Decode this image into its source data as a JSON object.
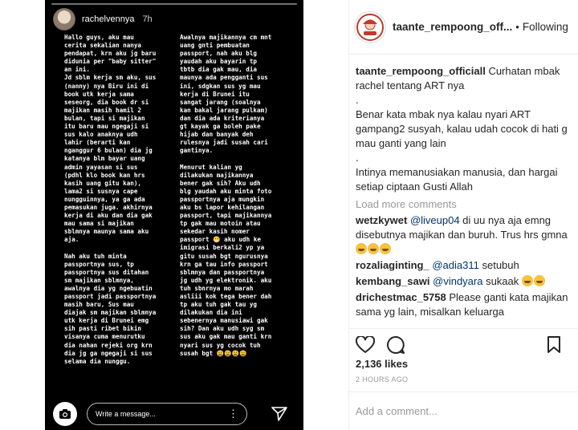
{
  "story": {
    "username": "rachelvennya",
    "time": "7h",
    "text_left": "Hallo guys, aku mau\ncerita sekalian nanya\npendapat, krn aku jg baru\ndidunia per \"baby sitter\"\nan ini.\nJd sblm kerja sm aku, sus\n(nanny) nya Biru ini di\nbook utk kerja sama\nseseorg, dia book dr si\nmajikan masih hamil 2\nbulan, tapi si majikan\nitu baru mau ngegaji si\nsus kalo anaknya udh\nlahir (berarti kan\nnganggur 6 bulan) dia jg\nkatanya blm bayar uang\nadmin yayasan si sus\n(pdhl klo book kan hrs\nkasih uang gitu kan),\nlama2 si susnya cape\nnungguinnya, ya ga ada\npemasukan juga. akhirnya\nkerja di aku dan dia gak\nmau sama si majikan\nsblmnya maunya sama aku\naja.\n\nNah aku tuh minta\npassportnya sus, tp\npassportnya sus ditahan\nsm majikan sblmnya,\nawalnya dia yg ngebuatin\npassport jadi passportnya\nmasih baru, Sus mau\ndiajak sm majikan sblmnya\nutk kerja di Brunei emg\nsih pasti ribet bikin\nvisanya cuma menurutku\ndia nahan rejeki org krn\ndia jg ga ngegaji si sus\nselama dia nunggu.",
    "text_right": "Awalnya majikannya cm mnt\nuang gnti pembuatan\npassport, nah aku blg\nyaudah aku bayarin tp\ntbtb dia gak mau, dia\nmaunya ada pengganti sus\nini, sdgkan sus yg mau\nkerja di Brunei itu\nsangat jarang (soalnya\nkan bakal jarang pulkam)\ndan dia ada kriterianya\ngt kayak ga boleh pake\nhijab dan banyak deh\nrulesnya jadi susah cari\ngantinya.\n\nMenurut kalian yg\ndilakukan majikannya\nbener gak sih? Aku udh\nblg yaudah aku minta foto\npassportnya aja mungkin\naku bs lapor kehilangan\npassport, tapi majikannya\ntp gak mau motoin atau\nsekedar kasih nomer\npassport 😬 aku udh ke\nimigrasi berkali2 yp ya\ngitu susah bgt ngurusnya\nkrn ga tau info passport\nsblmnya dan passportnya\njg udh yg elektronik. aku\ntuh sbnrnya mo marah\nasliii kok tega bener dah\ntp aku tuh gak tau yg\ndilakukan dia ini\nsebenernya manusiawi gak\nsih? Dan aku udh syg sm\nsus aku gak mau ganti krn\nnyari sus yg cocok tuh\nsusah bgt 😩😩😩😩",
    "message_placeholder": "Write a message...",
    "more_glyph": "⋮"
  },
  "post": {
    "username": "taante_rempoong_off...",
    "separator": "•",
    "follow_label": "Following",
    "caption": {
      "username": "taante_rempoong_officiall",
      "lines": [
        "Curhatan mbak rachel tentang ART nya",
        ".",
        "Benar kata mbak nya kalau nyari ART gampang2 susyah, kalau udah cocok di hati g mau ganti yang lain",
        ".",
        "Intinya memanusiakan manusia, dan hargai setiap ciptaan Gusti Allah"
      ]
    },
    "load_more": "Load more comments",
    "comments": [
      {
        "user": "wetzkywet",
        "mention": "@liveup04",
        "text": " di uu nya aja emng disebutnya majikan dan buruh. Trus hrs gmna ",
        "emoji": 3
      },
      {
        "user": "rozaliaginting_",
        "mention": "@adia311",
        "text": " setubuh",
        "emoji": 0
      },
      {
        "user": "kembang_sawi",
        "mention": "@vindyara",
        "text": " sukaak ",
        "emoji": 2
      },
      {
        "user": "drichestmac_5758",
        "mention": "",
        "text": " Please ganti kata majikan sama yg lain, misalkan keluarga",
        "emoji": 0
      }
    ],
    "likes": "2,136 likes",
    "time": "2 HOURS AGO",
    "add_comment_placeholder": "Add a comment..."
  },
  "colors": {
    "mention": "#003569",
    "muted": "#999999",
    "story_bg": "#000000"
  }
}
